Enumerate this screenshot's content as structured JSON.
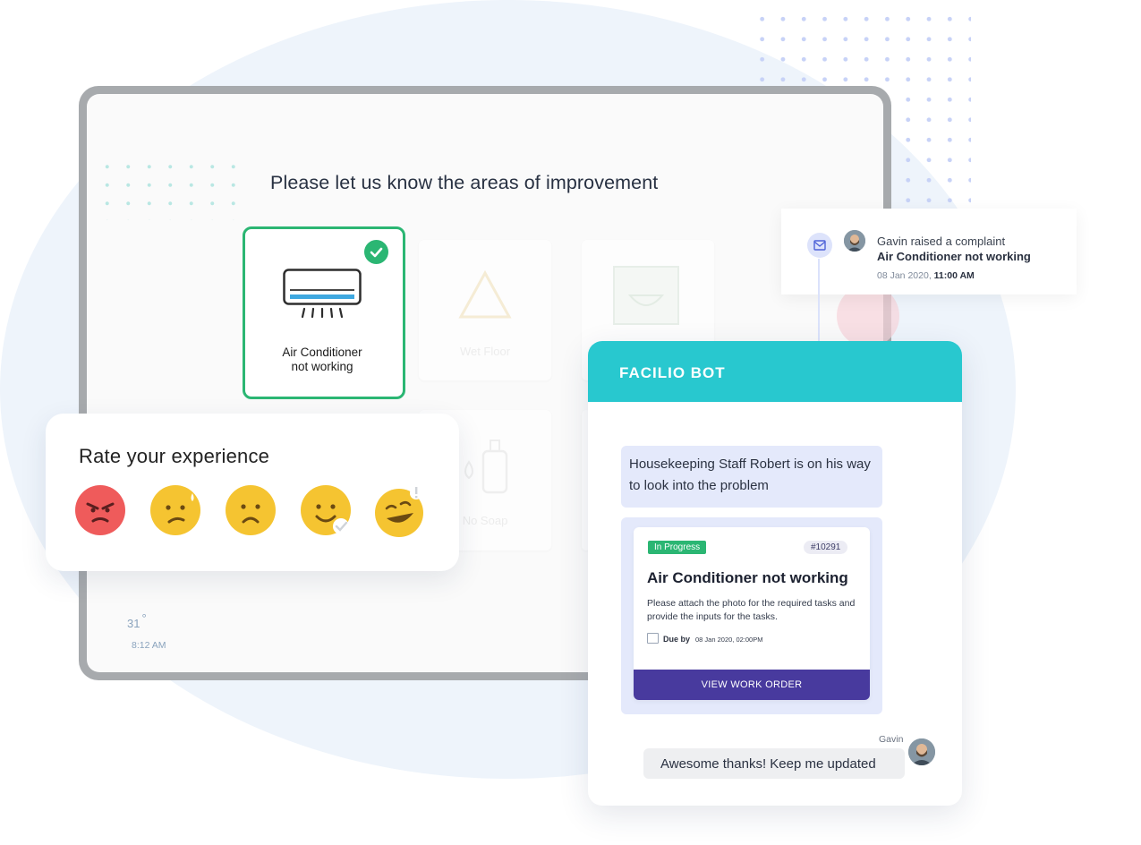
{
  "survey": {
    "title": "Please let us know the areas of improvement",
    "options": [
      {
        "label": "Air Conditioner not working",
        "line1": "Air Conditioner",
        "line2": "not working",
        "selected": true,
        "icon": "air-conditioner-icon"
      },
      {
        "label": "Wet Floor",
        "selected": false,
        "icon": "wet-floor-icon"
      },
      {
        "label": "",
        "selected": false,
        "icon": "sink-icon"
      },
      {
        "label": "No Soap",
        "selected": false,
        "icon": "soap-icon"
      }
    ]
  },
  "rating": {
    "title": "Rate your experience",
    "emojis": [
      "angry-face-icon",
      "worried-face-icon",
      "sad-face-icon",
      "smiling-face-icon",
      "laughing-face-icon"
    ]
  },
  "status": {
    "temperature": "31",
    "degree": "°",
    "time": "8:12 AM"
  },
  "notification": {
    "text": "Gavin raised a complaint",
    "subject": "Air Conditioner not working",
    "date": "08 Jan 2020",
    "separator": ",",
    "time": "11:00 AM",
    "icon": "mail-icon"
  },
  "bot": {
    "title": "FACILIO BOT",
    "message": "Housekeeping Staff Robert is on his way to look into the problem",
    "work_order": {
      "status": "In Progress",
      "id": "#10291",
      "title": "Air Conditioner not working",
      "description": "Please attach the photo for the required tasks and provide the inputs for the tasks.",
      "due_label": "Due by",
      "due_value": "08 Jan 2020, 02:00PM",
      "button": "VIEW WORK ORDER"
    },
    "reply": {
      "sender": "Gavin",
      "text": "Awesome thanks! Keep me updated"
    }
  },
  "colors": {
    "accent_teal": "#28c8cf",
    "success_green": "#2bb673",
    "primary_purple": "#483a9e"
  }
}
